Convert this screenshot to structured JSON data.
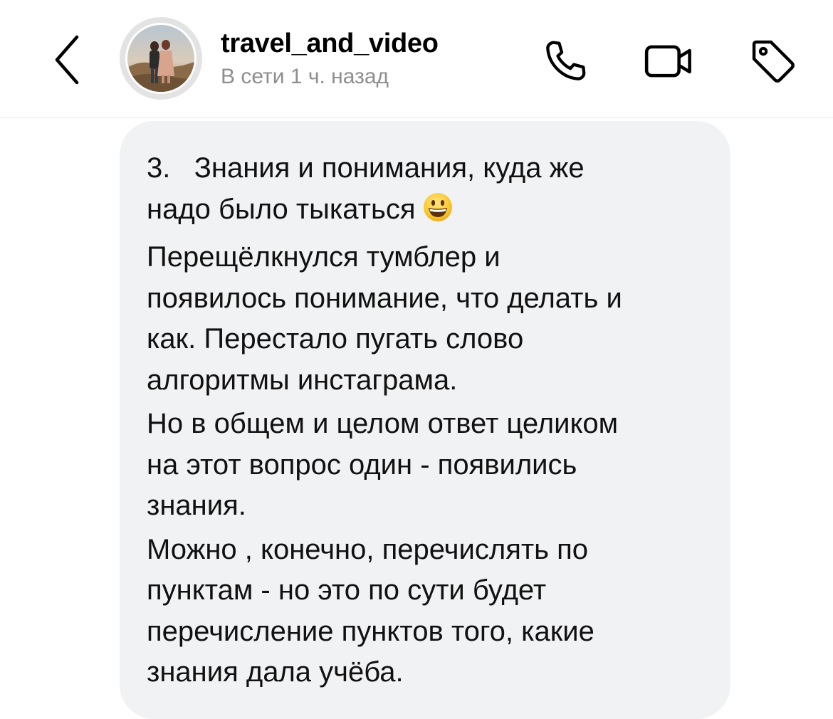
{
  "header": {
    "username": "travel_and_video",
    "status": "В сети 1 ч. назад",
    "icons": {
      "back": "chevron-left-icon",
      "call": "phone-icon",
      "video": "video-camera-icon",
      "tag": "tag-icon"
    }
  },
  "message": {
    "line_1": "3.   Знания и понимания, куда же\nнадо было тыкаться",
    "emoji": "grinning-face-emoji",
    "paragraph_2": "Перещёлкнулся тумблер и\nпоявилось понимание, что делать и\nкак. Перестало пугать слово\nалгоритмы инстаграма.",
    "paragraph_3": "Но в общем и целом ответ целиком\nна этот вопрос один - появились\nзнания.",
    "paragraph_4": "Можно , конечно, перечислять по\nпунктам - но это по сути будет\nперечисление пунктов того, какие\nзнания дала учёба."
  },
  "colors": {
    "bubble_background": "#f1f2f4",
    "status_text": "#8e8e8e",
    "divider": "#ececec"
  }
}
